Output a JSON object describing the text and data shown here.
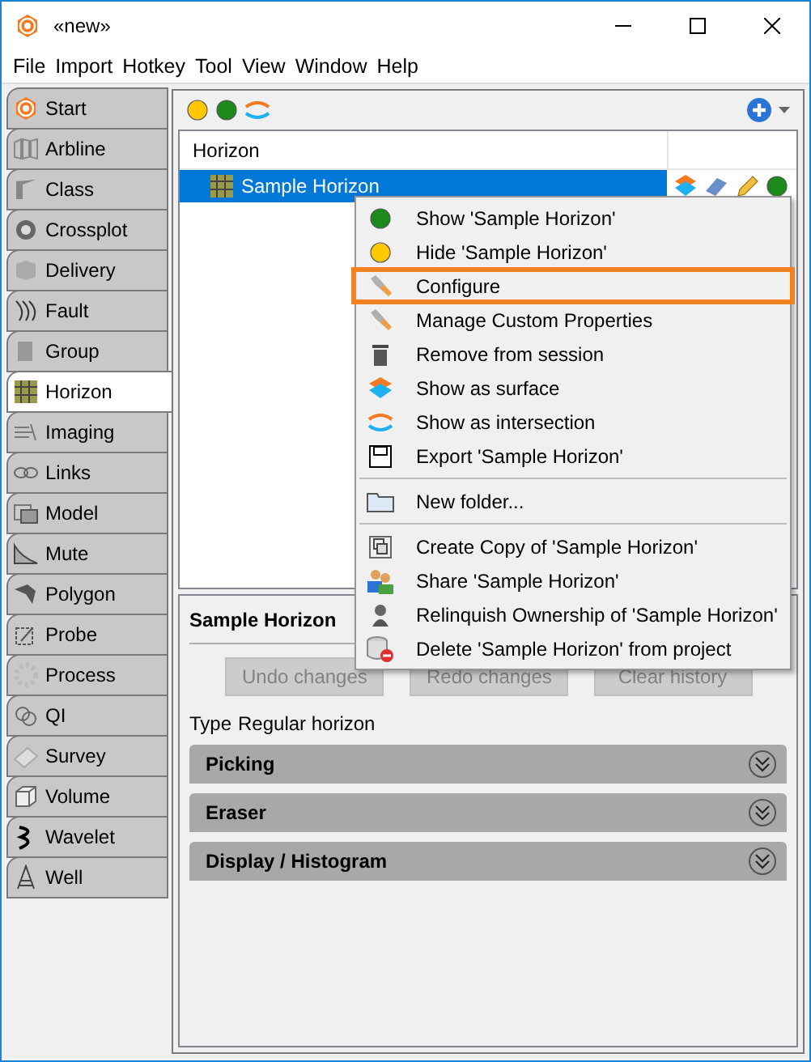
{
  "window": {
    "title": "«new»"
  },
  "menu": [
    "File",
    "Import",
    "Hotkey",
    "Tool",
    "View",
    "Window",
    "Help"
  ],
  "sidebar": {
    "tabs": [
      {
        "label": "Start",
        "selected": false
      },
      {
        "label": "Arbline",
        "selected": false
      },
      {
        "label": "Class",
        "selected": false
      },
      {
        "label": "Crossplot",
        "selected": false
      },
      {
        "label": "Delivery",
        "selected": false
      },
      {
        "label": "Fault",
        "selected": false
      },
      {
        "label": "Group",
        "selected": false
      },
      {
        "label": "Horizon",
        "selected": true
      },
      {
        "label": "Imaging",
        "selected": false
      },
      {
        "label": "Links",
        "selected": false
      },
      {
        "label": "Model",
        "selected": false
      },
      {
        "label": "Mute",
        "selected": false
      },
      {
        "label": "Polygon",
        "selected": false
      },
      {
        "label": "Probe",
        "selected": false
      },
      {
        "label": "Process",
        "selected": false
      },
      {
        "label": "QI",
        "selected": false
      },
      {
        "label": "Survey",
        "selected": false
      },
      {
        "label": "Volume",
        "selected": false
      },
      {
        "label": "Wavelet",
        "selected": false
      },
      {
        "label": "Well",
        "selected": false
      }
    ]
  },
  "tree": {
    "column": "Horizon",
    "rows": [
      {
        "label": "Sample Horizon",
        "selected": true
      }
    ]
  },
  "context_menu": [
    {
      "kind": "item",
      "label": "Show 'Sample Horizon'",
      "highlighted": false
    },
    {
      "kind": "item",
      "label": "Hide 'Sample Horizon'",
      "highlighted": false
    },
    {
      "kind": "item",
      "label": "Configure",
      "highlighted": true
    },
    {
      "kind": "item",
      "label": "Manage Custom Properties",
      "highlighted": false
    },
    {
      "kind": "item",
      "label": "Remove from session",
      "highlighted": false
    },
    {
      "kind": "item",
      "label": "Show as surface",
      "highlighted": false
    },
    {
      "kind": "item",
      "label": "Show as intersection",
      "highlighted": false
    },
    {
      "kind": "item",
      "label": "Export 'Sample Horizon'",
      "highlighted": false
    },
    {
      "kind": "separator"
    },
    {
      "kind": "item",
      "label": "New folder...",
      "highlighted": false
    },
    {
      "kind": "separator"
    },
    {
      "kind": "item",
      "label": "Create Copy of 'Sample Horizon'",
      "highlighted": false
    },
    {
      "kind": "item",
      "label": "Share 'Sample Horizon'",
      "highlighted": false
    },
    {
      "kind": "item",
      "label": "Relinquish Ownership of 'Sample Horizon'",
      "highlighted": false
    },
    {
      "kind": "item",
      "label": "Delete 'Sample Horizon' from project",
      "highlighted": false
    }
  ],
  "details": {
    "title": "Sample Horizon",
    "buttons": [
      {
        "label": "Undo changes",
        "disabled": true
      },
      {
        "label": "Redo changes",
        "disabled": true
      },
      {
        "label": "Clear history",
        "disabled": true
      }
    ],
    "type_label": "Type",
    "type_value": "Regular horizon",
    "sections": [
      {
        "title": "Picking",
        "expanded": false
      },
      {
        "title": "Eraser",
        "expanded": false
      },
      {
        "title": "Display / Histogram",
        "expanded": false
      }
    ]
  }
}
